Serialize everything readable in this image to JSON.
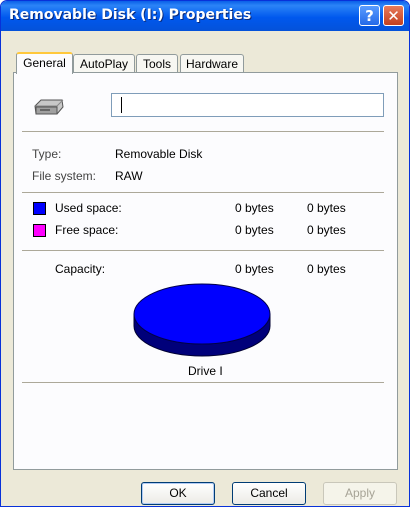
{
  "window": {
    "title": "Removable Disk (I:) Properties"
  },
  "title_buttons": {
    "help": "?",
    "close": "✕"
  },
  "tabs": [
    {
      "label": "General",
      "active": true
    },
    {
      "label": "AutoPlay",
      "active": false
    },
    {
      "label": "Tools",
      "active": false
    },
    {
      "label": "Hardware",
      "active": false
    }
  ],
  "general": {
    "drive_icon": "removable-drive-icon",
    "label_value": "",
    "type_label": "Type:",
    "type_value": "Removable Disk",
    "fs_label": "File system:",
    "fs_value": "RAW",
    "used_label": "Used space:",
    "used_bytes": "0 bytes",
    "used_size": "0 bytes",
    "used_color": "#0000ff",
    "free_label": "Free space:",
    "free_bytes": "0 bytes",
    "free_size": "0 bytes",
    "free_color": "#ff00ff",
    "capacity_label": "Capacity:",
    "capacity_bytes": "0 bytes",
    "capacity_size": "0 bytes",
    "pie_color": "#0000ff",
    "drive_caption": "Drive I"
  },
  "buttons": {
    "ok": "OK",
    "cancel": "Cancel",
    "apply": "Apply"
  }
}
